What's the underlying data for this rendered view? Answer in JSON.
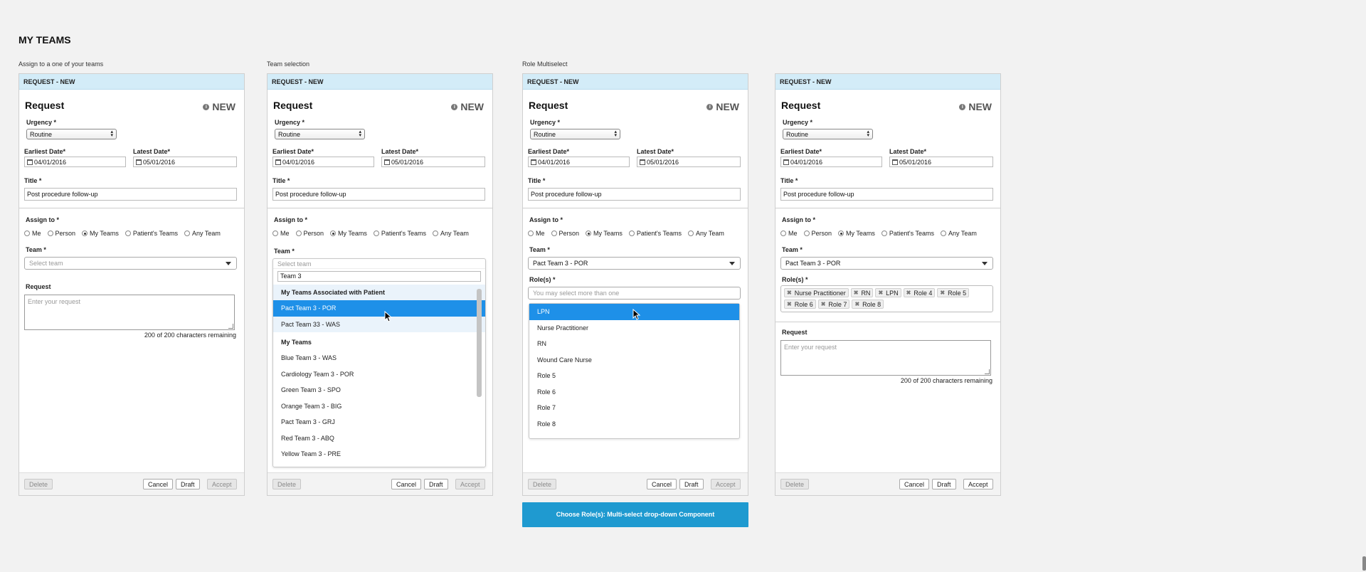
{
  "page": {
    "title": "MY TEAMS"
  },
  "cta": {
    "label": "Choose Role(s): Multi-select drop-down Component"
  },
  "form": {
    "header": "REQUEST - NEW",
    "heading": "Request",
    "new_badge": "NEW",
    "info_icon": "i",
    "urgency_label": "Urgency",
    "urgency_value": "Routine",
    "earliest_label": "Earliest Date*",
    "earliest_value": "04/01/2016",
    "latest_label": "Latest Date*",
    "latest_value": "05/01/2016",
    "title_label": "Title",
    "title_value": "Post procedure follow-up",
    "assign_label": "Assign to *",
    "assign_options": [
      "Me",
      "Person",
      "My Teams",
      "Patient's Teams",
      "Any Team"
    ],
    "assign_selected": "My Teams",
    "team_label": "Team",
    "team_placeholder": "Select team",
    "team_selected": "Pact Team 3  - POR",
    "roles_label": "Role(s)",
    "roles_placeholder": "You may select more than one",
    "request_label": "Request",
    "request_placeholder": "Enter your request",
    "remaining": "200 of 200 characters remaining",
    "star": "*",
    "buttons": {
      "delete": "Delete",
      "cancel": "Cancel",
      "draft": "Draft",
      "accept": "Accept"
    }
  },
  "panels": [
    {
      "caption": "Assign to a one of your teams"
    },
    {
      "caption": "Team selection"
    },
    {
      "caption": "Role Multiselect"
    },
    {
      "caption": ""
    }
  ],
  "team_dropdown": {
    "search_value": "Team 3",
    "group_associated": "My Teams Associated with Patient",
    "associated": [
      "Pact Team 3  - POR",
      "Pact Team 33  - WAS"
    ],
    "highlighted": "Pact Team 3  - POR",
    "group_my": "My Teams",
    "my_teams": [
      "Blue Team 3  - WAS",
      "Cardiology Team 3  - POR",
      "Green Team 3  - SPO",
      "Orange Team 3  - BIG",
      "Pact Team 3  - GRJ",
      "Red Team 3  - ABQ",
      "Yellow Team 3  - PRE"
    ]
  },
  "role_dropdown": {
    "options": [
      "LPN",
      "Nurse Practitioner",
      "RN",
      "Wound Care Nurse",
      "Role 5",
      "Role 6",
      "Role 7",
      "Role 8"
    ],
    "highlighted": "LPN"
  },
  "selected_roles": [
    "Nurse Practitioner",
    "RN",
    "LPN",
    "Role 4",
    "Role 5",
    "Role 6",
    "Role 7",
    "Role 8"
  ],
  "colors": {
    "header_bg": "#d3ecf8",
    "highlight": "#1e90e8",
    "cta": "#1f9ad0"
  }
}
